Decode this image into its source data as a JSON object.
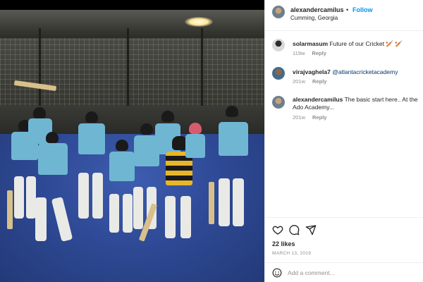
{
  "post": {
    "author": "alexandercamilus",
    "follow_label": "Follow",
    "location": "Cumming, Georgia",
    "separator": "•"
  },
  "comments": [
    {
      "username": "solarmasum",
      "text": "Future of our Cricket 🏏 🏏",
      "time": "119w",
      "reply_label": "Reply"
    },
    {
      "username": "virajvaghela7",
      "text": "",
      "mention": "@atlantacricketacademy",
      "time": "201w",
      "reply_label": "Reply"
    },
    {
      "username": "alexandercamilus",
      "text": "The basic start here.. At the Ado Academy...",
      "time": "201w",
      "reply_label": "Reply"
    }
  ],
  "footer": {
    "likes": "22 likes",
    "date": "MARCH 13, 2019",
    "add_comment_placeholder": "Add a comment..."
  },
  "icons": {
    "like": "heart-icon",
    "comment": "speech-bubble-icon",
    "share": "paper-plane-icon",
    "emoji": "smiley-icon"
  },
  "colors": {
    "follow": "#0095f6",
    "floor": "#2f4a96",
    "jersey": "#6fb6d3"
  }
}
